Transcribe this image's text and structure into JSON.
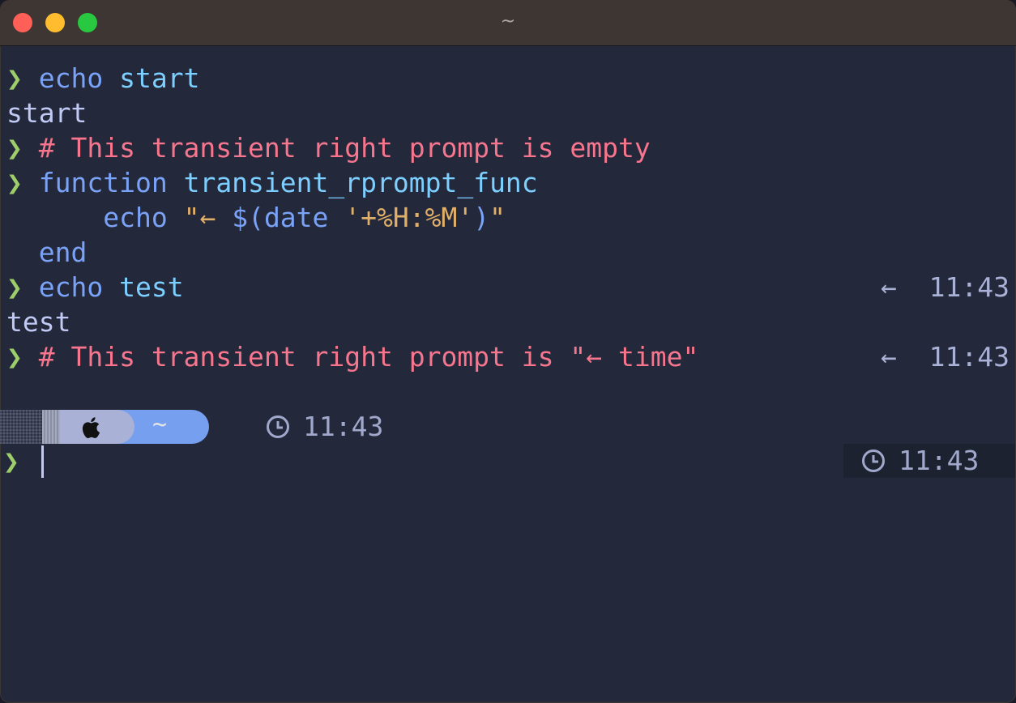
{
  "window": {
    "title": "~"
  },
  "terminal": {
    "lines": [
      {
        "prompt": "❯",
        "cmd": "echo",
        "arg": "start"
      },
      {
        "output": "start"
      },
      {
        "prompt": "❯",
        "comment": "# This transient right prompt is empty"
      },
      {
        "prompt": "❯",
        "cmd": "function",
        "arg": "transient_rprompt_func"
      },
      {
        "indent": "    ",
        "cmd": "echo",
        "str_open": "\"← ",
        "sub": "$(date",
        "str_mid": " '+%H:%M'",
        "sub_close": ")",
        "str_close": "\""
      },
      {
        "cmd": "end"
      },
      {
        "prompt": "❯",
        "cmd": "echo",
        "arg": "test",
        "rprompt": "←  11:43"
      },
      {
        "output": "test"
      },
      {
        "prompt": "❯",
        "comment": "# This transient right prompt is \"← time\"",
        "rprompt": "←  11:43"
      }
    ],
    "powerline": {
      "os_icon": "apple-icon",
      "dir": "~",
      "time_icon": "clock-icon",
      "time": "11:43"
    },
    "current_prompt": "❯",
    "right_time": "11:43",
    "colors": {
      "background": "#24283b",
      "prompt_arrow": "#9ece6a",
      "command": "#7aa2f7",
      "argument": "#7dcfff",
      "comment": "#f7768e",
      "string": "#e0af68",
      "text": "#c0caf5"
    }
  }
}
